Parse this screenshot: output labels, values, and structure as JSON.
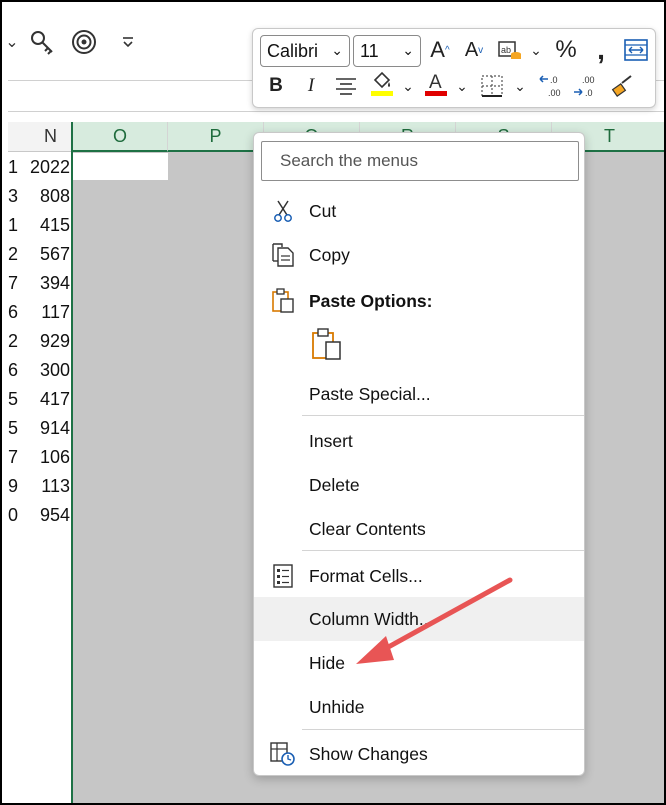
{
  "toolbar": {
    "icons": [
      "key-icon",
      "target-icon",
      "dropdown-caret-icon"
    ]
  },
  "columns": [
    "N",
    "O",
    "P",
    "Q",
    "R",
    "S",
    "T"
  ],
  "rows": [
    {
      "row_fragment": "1",
      "value": "2022"
    },
    {
      "row_fragment": "3",
      "value": "808"
    },
    {
      "row_fragment": "1",
      "value": "415"
    },
    {
      "row_fragment": "2",
      "value": "567"
    },
    {
      "row_fragment": "7",
      "value": "394"
    },
    {
      "row_fragment": "6",
      "value": "117"
    },
    {
      "row_fragment": "2",
      "value": "929"
    },
    {
      "row_fragment": "6",
      "value": "300"
    },
    {
      "row_fragment": "5",
      "value": "417"
    },
    {
      "row_fragment": "5",
      "value": "914"
    },
    {
      "row_fragment": "7",
      "value": "106"
    },
    {
      "row_fragment": "9",
      "value": "113"
    },
    {
      "row_fragment": "0",
      "value": "954"
    }
  ],
  "mini_toolbar": {
    "font_name": "Calibri",
    "font_size": "11",
    "bold": "B",
    "italic": "I",
    "fill_color": "#ffff00",
    "font_color": "#e00000"
  },
  "context_menu": {
    "search_placeholder": "Search the menus",
    "cut": "Cut",
    "copy": "Copy",
    "paste_options": "Paste Options:",
    "paste_special": "Paste Special...",
    "insert": "Insert",
    "delete": "Delete",
    "clear_contents": "Clear Contents",
    "format_cells": "Format Cells...",
    "column_width": "Column Width...",
    "hide": "Hide",
    "unhide": "Unhide",
    "show_changes": "Show Changes"
  },
  "colors": {
    "selection_green": "#1e7145",
    "annotation_arrow": "#e85555"
  }
}
